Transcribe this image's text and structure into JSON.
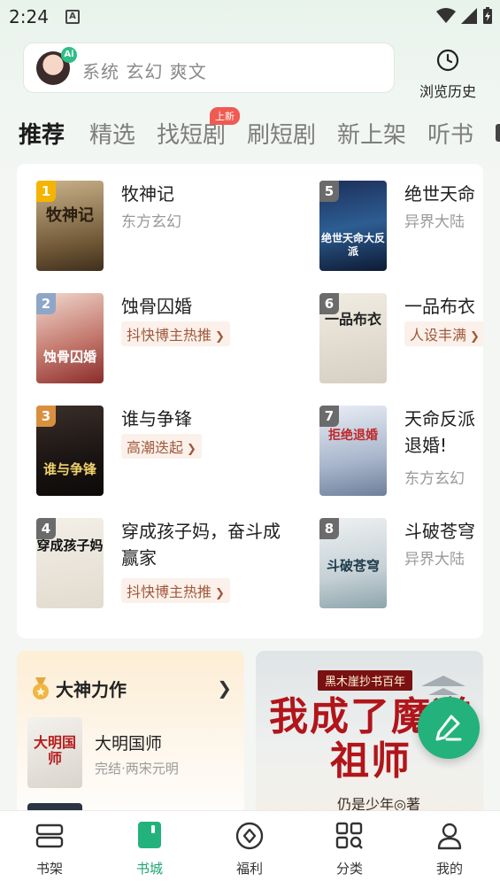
{
  "status_bar": {
    "time": "2:24",
    "notification_icon": "A"
  },
  "search": {
    "placeholder": "系统 玄幻 爽文",
    "ai_badge": "Ai"
  },
  "history": {
    "label": "浏览历史"
  },
  "tabs": [
    {
      "label": "推荐",
      "active": true
    },
    {
      "label": "精选"
    },
    {
      "label": "找短剧",
      "badge": "上新"
    },
    {
      "label": "刷短剧"
    },
    {
      "label": "新上架"
    },
    {
      "label": "听书"
    }
  ],
  "ranking": [
    {
      "rank": "1",
      "title": "牧神记",
      "subtitle": "东方玄幻",
      "cover_text": "牧神记"
    },
    {
      "rank": "2",
      "title": "蚀骨囚婚",
      "tag": "抖快博主热推",
      "cover_text": "蚀骨囚婚"
    },
    {
      "rank": "3",
      "title": "谁与争锋",
      "tag": "高潮迭起",
      "cover_text": "谁与争锋"
    },
    {
      "rank": "4",
      "title": "穿成孩子妈，奋斗成",
      "title_line2": "赢家",
      "tag": "抖快博主热推",
      "cover_text": "穿成孩子妈"
    },
    {
      "rank": "5",
      "title": "绝世天命",
      "subtitle": "异界大陆",
      "cover_text": "绝世天命大反派"
    },
    {
      "rank": "6",
      "title": "一品布衣",
      "tag": "人设丰满",
      "cover_text": "一品布衣"
    },
    {
      "rank": "7",
      "title": "天命反派",
      "title_line2": "退婚!",
      "subtitle": "东方玄幻",
      "cover_text": "拒绝退婚"
    },
    {
      "rank": "8",
      "title": "斗破苍穹",
      "subtitle": "异界大陆",
      "cover_text": "斗破苍穹"
    }
  ],
  "god_section": {
    "title": "大神力作",
    "book_title": "大明国师",
    "book_sub": "完结·两宋元明",
    "cover_text": "大明国师"
  },
  "banner": {
    "top_text": "黑木崖抄书百年",
    "title": "我成了魔道祖师",
    "author": "仍是少年◎著"
  },
  "nav": [
    {
      "label": "书架",
      "icon": "bookshelf-icon"
    },
    {
      "label": "书城",
      "icon": "bookstore-icon",
      "active": true
    },
    {
      "label": "福利",
      "icon": "welfare-icon"
    },
    {
      "label": "分类",
      "icon": "category-icon"
    },
    {
      "label": "我的",
      "icon": "profile-icon"
    }
  ],
  "colors": {
    "accent": "#23b27b",
    "rank_gold": "#f5b400",
    "rank_silver": "#8ea7c8",
    "rank_bronze": "#d9903e",
    "rank_gray": "#6b6b6b"
  }
}
